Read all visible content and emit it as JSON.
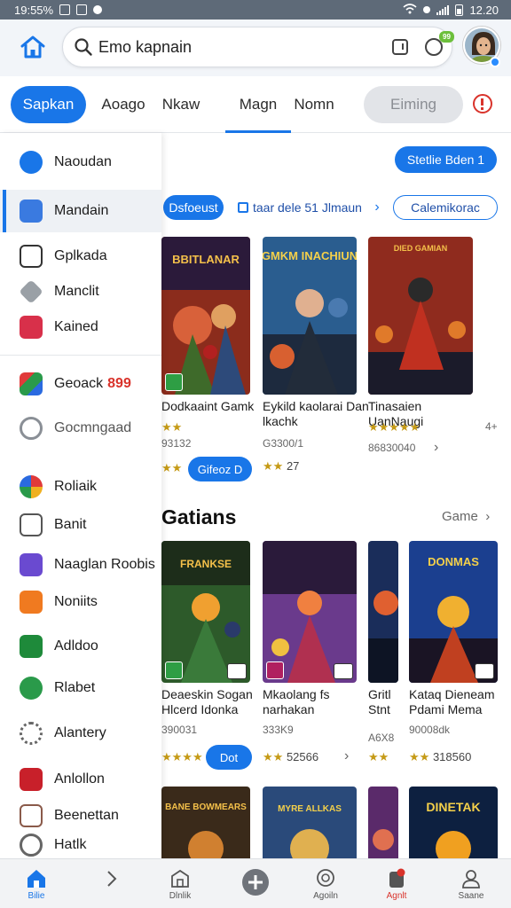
{
  "status_bar": {
    "time_left": "19:55%",
    "time_right": "12.20"
  },
  "header": {
    "search": {
      "placeholder": "Emo kapnain"
    },
    "mic_badge": "99"
  },
  "tabs": [
    {
      "label": "Sapkan",
      "state": "active-pill"
    },
    {
      "label": "Aoago",
      "state": "normal"
    },
    {
      "label": "Nkaw",
      "state": "normal"
    },
    {
      "label": "Magn",
      "state": "underline"
    },
    {
      "label": "Nomn",
      "state": "normal"
    },
    {
      "label": "Eiming",
      "state": "grey-pill"
    }
  ],
  "drawer": {
    "items": [
      {
        "label": "Naoudan",
        "icon": "blue-circle-icon"
      },
      {
        "label": "Mandain",
        "icon": "blue-grid-icon",
        "active": true
      },
      {
        "label": "Gplkada",
        "icon": "dark-square-icon"
      },
      {
        "label": "Manclit",
        "icon": "grey-tag-icon"
      },
      {
        "label": "Kained",
        "icon": "red-camera-icon"
      },
      {
        "label": "Geoack",
        "badge": "899",
        "icon": "colorful-puzzle-icon"
      },
      {
        "label": "Gocmngaad",
        "icon": "grey-ring-icon"
      },
      {
        "label": "Roliaik",
        "icon": "colorful-circle-icon"
      },
      {
        "label": "Banit",
        "icon": "grid-box-icon"
      },
      {
        "label": "Naaglan Roobis",
        "icon": "purple-diamond-icon"
      },
      {
        "label": "Noniits",
        "icon": "orange-cube-icon"
      },
      {
        "label": "Adldoo",
        "icon": "green-badge-icon"
      },
      {
        "label": "Rlabet",
        "icon": "green-leaf-icon"
      },
      {
        "label": "Alantery",
        "icon": "grey-gear-icon"
      },
      {
        "label": "Anlollon",
        "icon": "red-square-icon"
      },
      {
        "label": "Beenettan",
        "icon": "person-icon"
      },
      {
        "label": "Hatlk",
        "icon": "grey-pin-icon"
      }
    ]
  },
  "main": {
    "promo_button": "Stetlie Bden 1",
    "chips": {
      "blue": "Dsfoeust",
      "link": "taar dele 51 Jlmaun",
      "outline": "Calemikorac"
    },
    "row1": [
      {
        "cover_text": "BBITLANAR",
        "title": "Dodkaaint Gamk",
        "meta": "93132",
        "rating_stars": "★★",
        "action": "Gifeoz D",
        "colors": [
          "#8b2c1c",
          "#d8613a",
          "#2b1a3a"
        ]
      },
      {
        "cover_text": "GMKM INACHIUN",
        "title": "Eykild kaolarai Dan lkachk",
        "meta": "G3300/1",
        "rating_stars": "★★",
        "rating_value": "27",
        "colors": [
          "#2a5d8f",
          "#e0b060",
          "#1d2a3e"
        ]
      },
      {
        "cover_text": "DIED GAMIAN",
        "title": "Tinasaien UanNaugi",
        "meta": "86830040",
        "rating_stars": "★★★★★",
        "extra": "4+",
        "colors": [
          "#8f2b1e",
          "#e07a2a",
          "#1b1b2a"
        ]
      }
    ],
    "section": {
      "title": "Gatians",
      "link": "Game"
    },
    "row2": [
      {
        "cover_text": "FRANKSE",
        "title": "Deaeskin Sogan Hlcerd Idonka",
        "meta": "390031",
        "rating_stars": "★★★★",
        "action": "Dot",
        "colors": [
          "#2d5a2a",
          "#f0a030",
          "#1d2d1a"
        ]
      },
      {
        "cover_text": "",
        "title": "Mkaolang fs narhakan",
        "meta": "333K9",
        "rating_stars": "★★",
        "rating_value": "52566",
        "colors": [
          "#6a3a8c",
          "#f08040",
          "#2a1a3a"
        ]
      },
      {
        "cover_text": "",
        "title": "Gritl Stnt",
        "meta": "A6X8",
        "rating_stars": "★★",
        "colors": [
          "#1a2d5a",
          "#e06030",
          "#0d1424"
        ]
      },
      {
        "cover_text": "DONMAS",
        "title": "Kataq Dieneam Pdami Mema",
        "meta": "90008dk",
        "rating_stars": "★★",
        "rating_value": "318560",
        "colors": [
          "#1b3f8f",
          "#f0b030",
          "#1a1424"
        ]
      }
    ],
    "row3": [
      {
        "cover_text": "BANE BOWMEARS",
        "colors": [
          "#3a2a1a",
          "#d08030"
        ]
      },
      {
        "cover_text": "MYRE ALLKAS",
        "colors": [
          "#2a4a7a",
          "#e0b050"
        ]
      },
      {
        "cover_text": "",
        "colors": [
          "#5a2a6a",
          "#e07050"
        ]
      },
      {
        "cover_text": "DINETAK",
        "colors": [
          "#0d2040",
          "#f0a020"
        ]
      }
    ]
  },
  "bottom_nav": [
    {
      "label": "Bilie",
      "icon": "home-icon",
      "state": "active"
    },
    {
      "label": "",
      "icon": "chevron-right-icon",
      "state": "normal"
    },
    {
      "label": "Dlnlik",
      "icon": "store-icon",
      "state": "normal"
    },
    {
      "label": "",
      "icon": "plus-circle-icon",
      "state": "normal"
    },
    {
      "label": "Agoiln",
      "icon": "chat-icon",
      "state": "normal"
    },
    {
      "label": "Agnlt",
      "icon": "notification-icon",
      "state": "red"
    },
    {
      "label": "Saane",
      "icon": "profile-icon",
      "state": "normal"
    }
  ],
  "colors": {
    "accent": "#1976e8",
    "alert": "#d9332b",
    "star": "#c59a16"
  }
}
